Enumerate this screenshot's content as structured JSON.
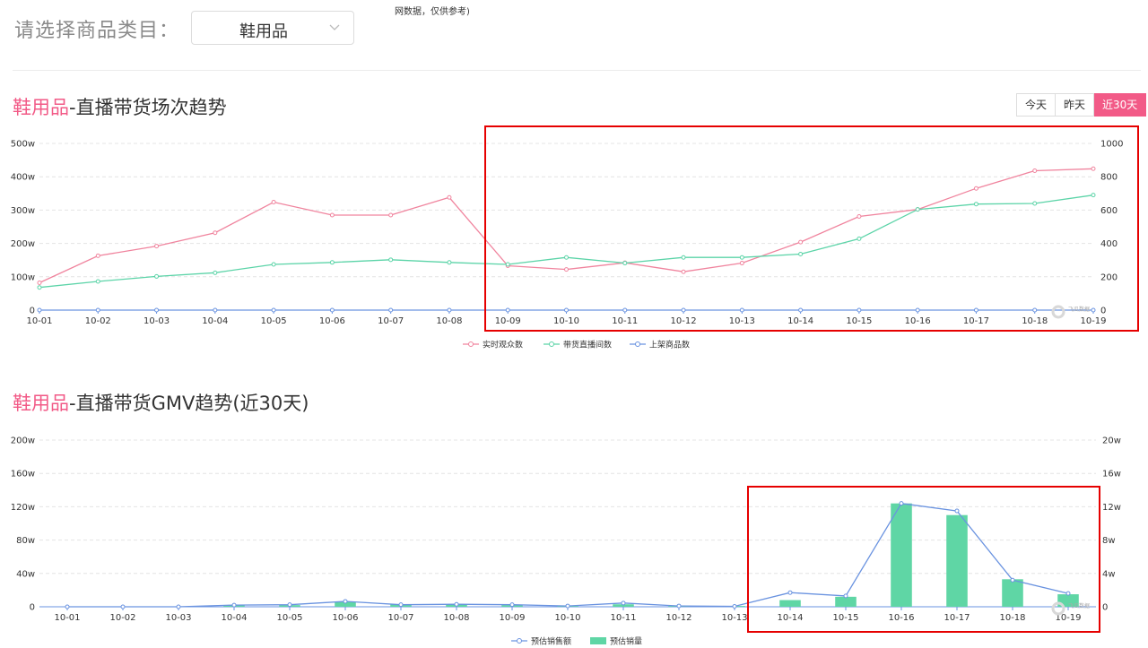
{
  "header": {
    "note": "网数据，仅供参考)",
    "category_label": "请选择商品类目：",
    "category_value": "鞋用品"
  },
  "chart1": {
    "title_highlight": "鞋用品",
    "title_rest": "-直播带货场次趋势",
    "tabs": [
      {
        "label": "今天",
        "active": false
      },
      {
        "label": "昨天",
        "active": false
      },
      {
        "label": "近30天",
        "active": true
      }
    ]
  },
  "chart2": {
    "title_highlight": "鞋用品",
    "title_rest": "-直播带货GMV趋势(近30天)"
  },
  "colors": {
    "pink": "#f0849e",
    "green": "#5cd4a8",
    "blue": "#6a93e0",
    "bar_green": "#5fd6a5",
    "accent": "#f25a87",
    "highlight_box": "#e60000"
  },
  "watermark": "飞瓜数据",
  "chart_data": [
    {
      "type": "line",
      "title": "鞋用品-直播带货场次趋势",
      "x": [
        "10-01",
        "10-02",
        "10-03",
        "10-04",
        "10-05",
        "10-06",
        "10-07",
        "10-08",
        "10-09",
        "10-10",
        "10-11",
        "10-12",
        "10-13",
        "10-14",
        "10-15",
        "10-16",
        "10-17",
        "10-18",
        "10-19"
      ],
      "yleft_ticks": [
        "0",
        "100w",
        "200w",
        "300w",
        "400w",
        "500w"
      ],
      "yleft_range": [
        0,
        500
      ],
      "yright_ticks": [
        "0",
        "200",
        "400",
        "600",
        "800",
        "1000"
      ],
      "yright_range": [
        0,
        1000
      ],
      "series": [
        {
          "name": "实时观众数",
          "axis": "left",
          "color": "#f0849e",
          "values": [
            82,
            163,
            192,
            232,
            324,
            285,
            285,
            338,
            133,
            122,
            142,
            115,
            141,
            204,
            281,
            302,
            365,
            418,
            424
          ]
        },
        {
          "name": "带货直播间数",
          "axis": "right",
          "color": "#5cd4a8",
          "values": [
            136,
            172,
            202,
            224,
            274,
            286,
            302,
            286,
            274,
            316,
            282,
            316,
            316,
            336,
            428,
            604,
            636,
            640,
            690
          ]
        },
        {
          "name": "上架商品数",
          "axis": "right",
          "color": "#6a93e0",
          "values": [
            0,
            0,
            0,
            0,
            0,
            0,
            0,
            0,
            0,
            0,
            0,
            0,
            0,
            0,
            0,
            0,
            0,
            0,
            0
          ]
        }
      ],
      "legend": "bottom-center",
      "grid": true
    },
    {
      "type": "bar",
      "title": "鞋用品-直播带货GMV趋势(近30天)",
      "x": [
        "10-01",
        "10-02",
        "10-03",
        "10-04",
        "10-05",
        "10-06",
        "10-07",
        "10-08",
        "10-09",
        "10-10",
        "10-11",
        "10-12",
        "10-13",
        "10-14",
        "10-15",
        "10-16",
        "10-17",
        "10-18",
        "10-19"
      ],
      "yleft_ticks": [
        "0",
        "40w",
        "80w",
        "120w",
        "160w",
        "200w"
      ],
      "yleft_range": [
        0,
        200
      ],
      "yright_ticks": [
        "0",
        "4w",
        "8w",
        "12w",
        "16w",
        "20w"
      ],
      "yright_range": [
        0,
        20
      ],
      "series": [
        {
          "name": "预估销售额",
          "axis": "left",
          "kind": "line",
          "color": "#6a93e0",
          "values": [
            0,
            0,
            0,
            2,
            2.5,
            6.5,
            2.5,
            3,
            2.5,
            1,
            4.5,
            1,
            0.5,
            17,
            13,
            124,
            115,
            32,
            16
          ]
        },
        {
          "name": "预估销量",
          "axis": "right",
          "kind": "bar",
          "color": "#5fd6a5",
          "values": [
            0,
            0,
            0,
            0.2,
            0.2,
            0.6,
            0.3,
            0.3,
            0.2,
            0.1,
            0.3,
            0.1,
            0.1,
            0.8,
            1.2,
            12.4,
            11.0,
            3.3,
            1.5
          ]
        }
      ],
      "legend": "bottom-center",
      "grid": true
    }
  ]
}
